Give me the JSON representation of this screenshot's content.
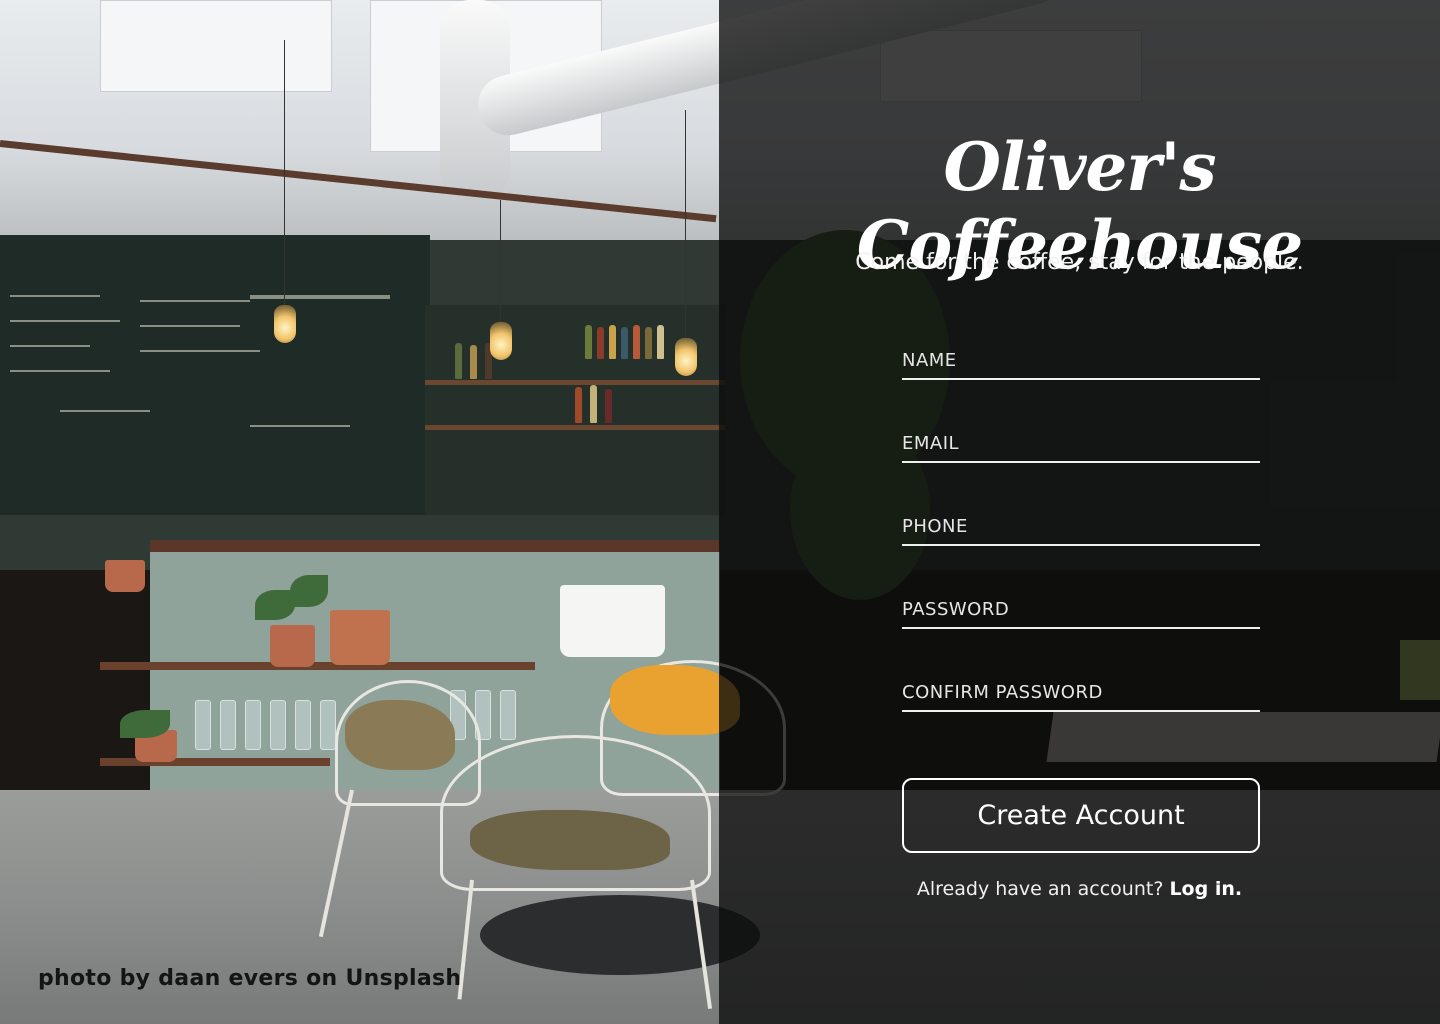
{
  "brand": {
    "title": "Oliver's Coffeehouse",
    "tagline": "Come for the coffee, stay for the people."
  },
  "form": {
    "fields": [
      {
        "id": "name",
        "placeholder": "NAME",
        "value": ""
      },
      {
        "id": "email",
        "placeholder": "EMAIL",
        "value": ""
      },
      {
        "id": "phone",
        "placeholder": "PHONE",
        "value": ""
      },
      {
        "id": "password",
        "placeholder": "PASSWORD",
        "value": ""
      },
      {
        "id": "confirm_password",
        "placeholder": "CONFIRM PASSWORD",
        "value": ""
      }
    ],
    "submit_label": "Create Account"
  },
  "login": {
    "prompt": "Already have an account?",
    "link_label": "Log in."
  },
  "credit": "photo by daan evers on Unsplash",
  "colors": {
    "overlay": "#0c0c0c",
    "text": "#ffffff",
    "credit_text": "#141414"
  }
}
